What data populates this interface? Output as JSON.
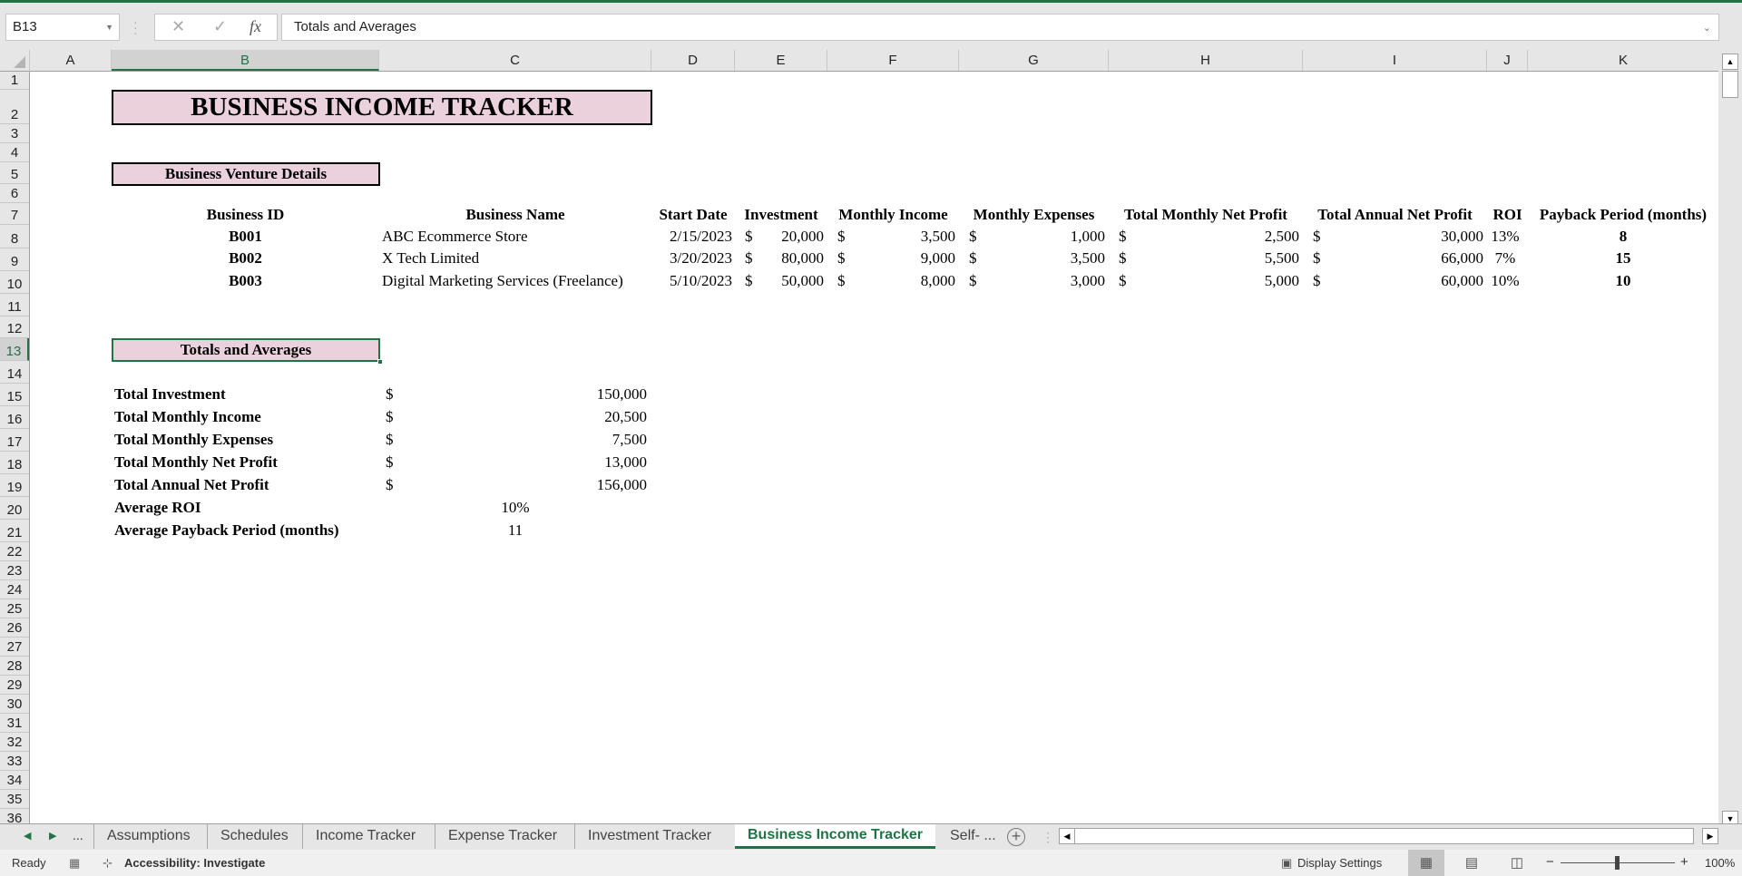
{
  "formula_bar": {
    "name_box": "B13",
    "cancel_icon": "✕",
    "enter_icon": "✓",
    "fx_label": "fx",
    "formula": "Totals and Averages"
  },
  "columns": [
    {
      "label": "A"
    },
    {
      "label": "B",
      "selected": true
    },
    {
      "label": "C"
    },
    {
      "label": "D"
    },
    {
      "label": "E"
    },
    {
      "label": "F"
    },
    {
      "label": "G"
    },
    {
      "label": "H"
    },
    {
      "label": "I"
    },
    {
      "label": "J"
    },
    {
      "label": "K"
    }
  ],
  "rows": [
    "1",
    "2",
    "3",
    "4",
    "5",
    "6",
    "7",
    "8",
    "9",
    "10",
    "11",
    "12",
    "13",
    "14",
    "15",
    "16",
    "17",
    "18",
    "19",
    "20",
    "21",
    "22",
    "23",
    "24",
    "25",
    "26",
    "27",
    "28",
    "29",
    "30",
    "31",
    "32",
    "33",
    "34",
    "35",
    "36"
  ],
  "selected_row": "13",
  "sheet": {
    "title": "BUSINESS INCOME TRACKER",
    "venture_section": "Business Venture Details",
    "headers": {
      "business_id": "Business ID",
      "business_name": "Business Name",
      "start_date": "Start Date",
      "investment": "Investment",
      "monthly_income": "Monthly Income",
      "monthly_expenses": "Monthly Expenses",
      "total_monthly_net_profit": "Total Monthly Net Profit",
      "total_annual_net_profit": "Total Annual Net Profit",
      "roi": "ROI",
      "payback_period": "Payback Period (months)"
    },
    "currency": "$",
    "ventures": [
      {
        "id": "B001",
        "name": "ABC Ecommerce Store",
        "start_date": "2/15/2023",
        "investment": "20,000",
        "monthly_income": "3,500",
        "monthly_expenses": "1,000",
        "monthly_net": "2,500",
        "annual_net": "30,000",
        "roi": "13%",
        "payback": "8"
      },
      {
        "id": "B002",
        "name": "X Tech Limited",
        "start_date": "3/20/2023",
        "investment": "80,000",
        "monthly_income": "9,000",
        "monthly_expenses": "3,500",
        "monthly_net": "5,500",
        "annual_net": "66,000",
        "roi": "7%",
        "payback": "15"
      },
      {
        "id": "B003",
        "name": "Digital Marketing Services (Freelance)",
        "start_date": "5/10/2023",
        "investment": "50,000",
        "monthly_income": "8,000",
        "monthly_expenses": "3,000",
        "monthly_net": "5,000",
        "annual_net": "60,000",
        "roi": "10%",
        "payback": "10"
      }
    ],
    "totals_section": "Totals and Averages",
    "totals": [
      {
        "label": "Total Investment",
        "currency": "$",
        "value": "150,000"
      },
      {
        "label": "Total Monthly Income",
        "currency": "$",
        "value": "20,500"
      },
      {
        "label": "Total Monthly Expenses",
        "currency": "$",
        "value": "7,500"
      },
      {
        "label": "Total Monthly Net Profit",
        "currency": "$",
        "value": "13,000"
      },
      {
        "label": "Total Annual Net Profit",
        "currency": "$",
        "value": "156,000"
      }
    ],
    "averages": [
      {
        "label": "Average ROI",
        "value": "10%"
      },
      {
        "label": "Average Payback Period (months)",
        "value": "11"
      }
    ]
  },
  "tabs": {
    "more": "...",
    "items": [
      "Assumptions",
      "Schedules",
      "Income Tracker",
      "Expense Tracker",
      "Investment Tracker",
      "Business Income Tracker",
      "Self- ..."
    ],
    "active": "Business Income Tracker"
  },
  "status_bar": {
    "ready": "Ready",
    "accessibility": "Accessibility: Investigate",
    "display_settings": "Display Settings",
    "zoom": "100%",
    "zoom_minus": "−",
    "zoom_plus": "+"
  },
  "colors": {
    "accent": "#217346",
    "header_fill": "#ead1dc"
  }
}
